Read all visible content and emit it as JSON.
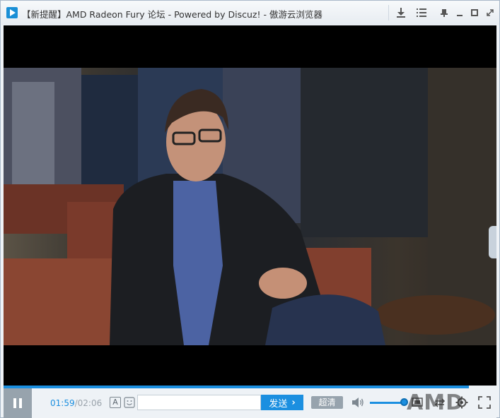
{
  "window": {
    "title": "【新提醒】AMD Radeon Fury 论坛 - Powered by Discuz! - 傲游云浏览器"
  },
  "player": {
    "current_time": "01:59",
    "separator": "/",
    "total_time": "02:06",
    "danmaku_toggle": "A",
    "send_label": "发送",
    "quality_label": "超清",
    "watermark": "AMD",
    "progress_fraction": 0.944,
    "volume_fraction": 0.85
  },
  "colors": {
    "accent": "#1b8fe0",
    "control_gray": "#97a3ad"
  }
}
